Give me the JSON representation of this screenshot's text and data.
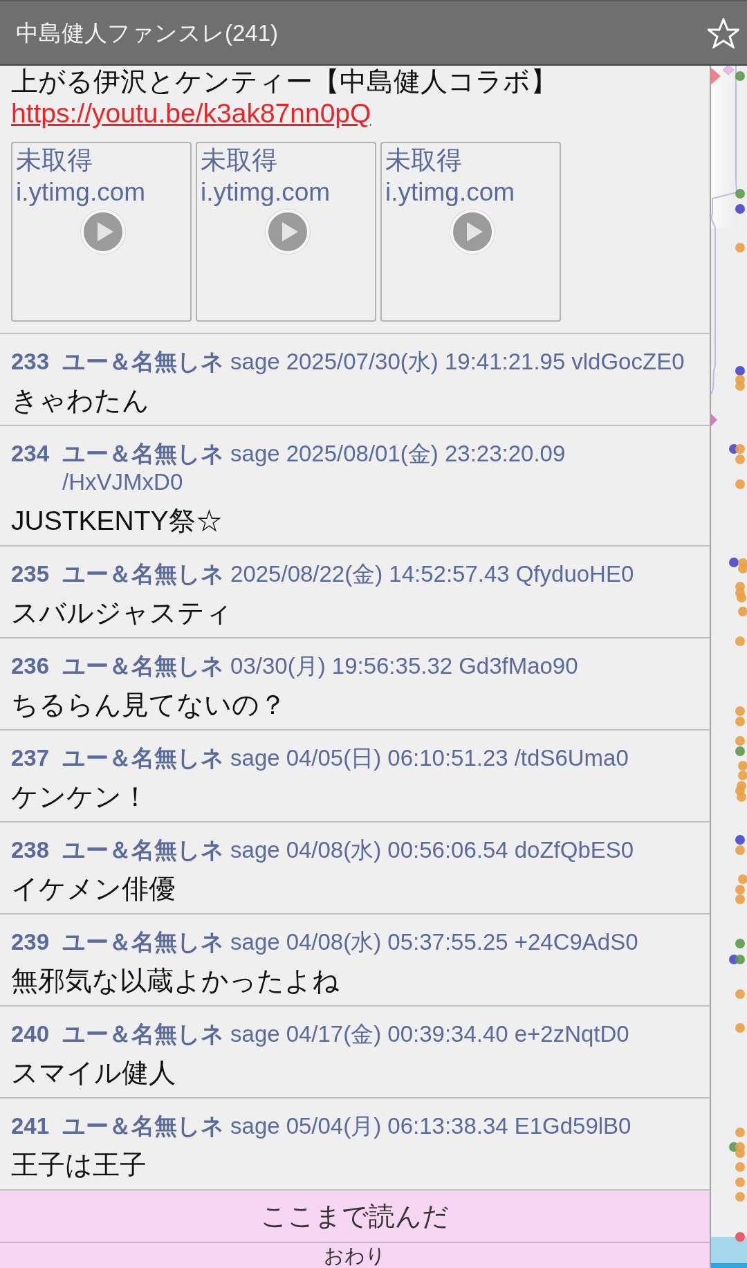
{
  "header": {
    "title": "中島健人ファンスレ(241)",
    "starred": false
  },
  "top_post": {
    "body": "上がる伊沢とケンティー【中島健人コラボ】",
    "link": "https://youtu.be/k3ak87nn0pQ",
    "thumbnails": [
      {
        "status": "未取得",
        "host": "i.ytimg.com"
      },
      {
        "status": "未取得",
        "host": "i.ytimg.com"
      },
      {
        "status": "未取得",
        "host": "i.ytimg.com"
      }
    ]
  },
  "posts": [
    {
      "number": "233",
      "name": "ユー＆名無しネ",
      "mail": "sage",
      "date": "2025/07/30(水) 19:41:21.95",
      "id": "vldGocZE0",
      "body": "きゃわたん"
    },
    {
      "number": "234",
      "name": "ユー＆名無しネ",
      "mail": "sage",
      "date": "2025/08/01(金) 23:23:20.09",
      "id": "/HxVJMxD0",
      "body": "JUSTKENTY祭☆"
    },
    {
      "number": "235",
      "name": "ユー＆名無しネ",
      "date": "2025/08/22(金) 14:52:57.43",
      "id": "QfyduoHE0",
      "body": "スバルジャスティ"
    },
    {
      "number": "236",
      "name": "ユー＆名無しネ",
      "date": "03/30(月) 19:56:35.32",
      "id": "Gd3fMao90",
      "body": "ちるらん見てないの？"
    },
    {
      "number": "237",
      "name": "ユー＆名無しネ",
      "mail": "sage",
      "date": "04/05(日) 06:10:51.23",
      "id": "/tdS6Uma0",
      "body": "ケンケン！"
    },
    {
      "number": "238",
      "name": "ユー＆名無しネ",
      "mail": "sage",
      "date": "04/08(水) 00:56:06.54",
      "id": "doZfQbES0",
      "body": "イケメン俳優"
    },
    {
      "number": "239",
      "name": "ユー＆名無しネ",
      "mail": "sage",
      "date": "04/08(水) 05:37:55.25",
      "id": "+24C9AdS0",
      "body": "無邪気な以蔵よかったよね"
    },
    {
      "number": "240",
      "name": "ユー＆名無しネ",
      "mail": "sage",
      "date": "04/17(金) 00:39:34.40",
      "id": "e+2zNqtD0",
      "body": "スマイル健人"
    },
    {
      "number": "241",
      "name": "ユー＆名無しネ",
      "mail": "sage",
      "date": "05/04(月) 06:13:38.34",
      "id": "E1Gd59lB0",
      "body": "王子は王子"
    }
  ],
  "read_marker": {
    "label": "ここまで読んだ"
  },
  "end_marker": {
    "label": "おわり"
  }
}
